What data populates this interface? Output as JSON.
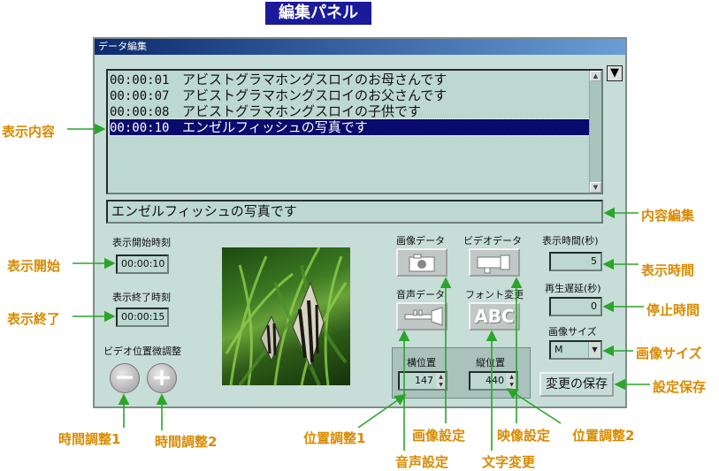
{
  "heading": "編集パネル",
  "window": {
    "title": "データ編集"
  },
  "list": {
    "items": [
      {
        "time": "00:00:01",
        "text": "アビストグラマホングスロイのお母さんです",
        "selected": false
      },
      {
        "time": "00:00:07",
        "text": "アビストグラマホングスロイのお父さんです",
        "selected": false
      },
      {
        "time": "00:00:08",
        "text": "アビストグラマホングスロイの子供です",
        "selected": false
      },
      {
        "time": "00:00:10",
        "text": "エンゼルフィッシュの写真です",
        "selected": true
      }
    ],
    "dropdown_glyph": "▼"
  },
  "editor": {
    "value": "エンゼルフィッシュの写真です"
  },
  "start": {
    "label": "表示開始時刻",
    "value": "00:00:10"
  },
  "end": {
    "label": "表示終了時刻",
    "value": "00:00:15"
  },
  "video_adjust": {
    "label": "ビデオ位置微調整",
    "minus": "−",
    "plus": "+"
  },
  "buttons": {
    "image_label": "画像データ",
    "video_label": "ビデオデータ",
    "audio_label": "音声データ",
    "font_label": "フォント変更",
    "font_glyph": "ABC"
  },
  "position": {
    "x_label": "横位置",
    "x_value": "147",
    "y_label": "縦位置",
    "y_value": "440"
  },
  "duration": {
    "label": "表示時間(秒)",
    "value": "5"
  },
  "delay": {
    "label": "再生遅延(秒)",
    "value": "0"
  },
  "image_size": {
    "label": "画像サイズ",
    "value": "M"
  },
  "save": {
    "label": "変更の保存"
  },
  "annotations": {
    "display_content": "表示内容",
    "display_start": "表示開始",
    "display_end": "表示終了",
    "time_adjust_1": "時間調整1",
    "time_adjust_2": "時間調整2",
    "position_adjust_1": "位置調整1",
    "image_setting": "画像設定",
    "video_setting": "映像設定",
    "position_adjust_2": "位置調整2",
    "audio_setting": "音声設定",
    "text_change": "文字変更",
    "content_edit": "内容編集",
    "display_time": "表示時間",
    "stop_time": "停止時間",
    "image_size": "画像サイズ",
    "settings_save": "設定保存"
  },
  "colors": {
    "panel": "#c7ddd7",
    "field": "#bcd8d0",
    "selection": "#0a0a6e",
    "annotation": "#d88a00",
    "heading_bg": "#1a1a9a"
  }
}
